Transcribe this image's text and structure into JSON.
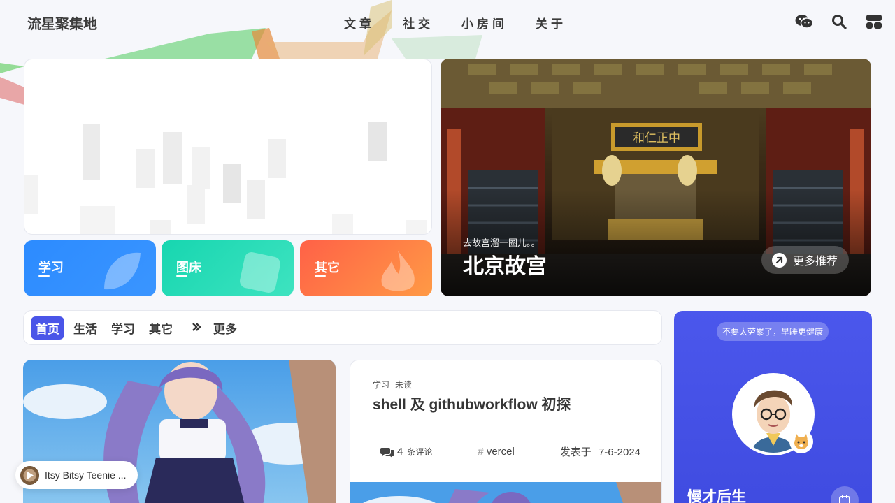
{
  "site": {
    "title": "流星聚集地"
  },
  "nav": {
    "items": [
      "文章",
      "社交",
      "小房间",
      "关于"
    ]
  },
  "header_icons": [
    "wechat-icon",
    "search-icon",
    "layout-icon"
  ],
  "categories": [
    {
      "label": "学习",
      "color_from": "#2c8bff",
      "color_to": "#3a95ff"
    },
    {
      "label": "图床",
      "color_from": "#17d6b0",
      "color_to": "#3ee3c0"
    },
    {
      "label": "其它",
      "color_from": "#ff6147",
      "color_to": "#ff9a45"
    }
  ],
  "feature": {
    "subtitle": "去故宫溜一圈儿。。",
    "title": "北京故宫",
    "more_label": "更多推荐"
  },
  "tabs": {
    "items": [
      "首页",
      "生活",
      "学习",
      "其它"
    ],
    "more_label": "更多",
    "active": "首页"
  },
  "post": {
    "tags": [
      "学习",
      "未读"
    ],
    "title": "shell 及 githubworkflow 初探",
    "comments_count": "4",
    "comments_label": "条评论",
    "topic": "vercel",
    "date_label": "发表于",
    "date": "7-6-2024"
  },
  "profile": {
    "pill": "不要太劳累了，早睡更健康",
    "name": "慢才后生"
  },
  "player": {
    "track": "Itsy Bitsy Teenie ..."
  },
  "colors": {
    "accent": "#4a55e8",
    "profile_bg": "#4b57ec"
  }
}
